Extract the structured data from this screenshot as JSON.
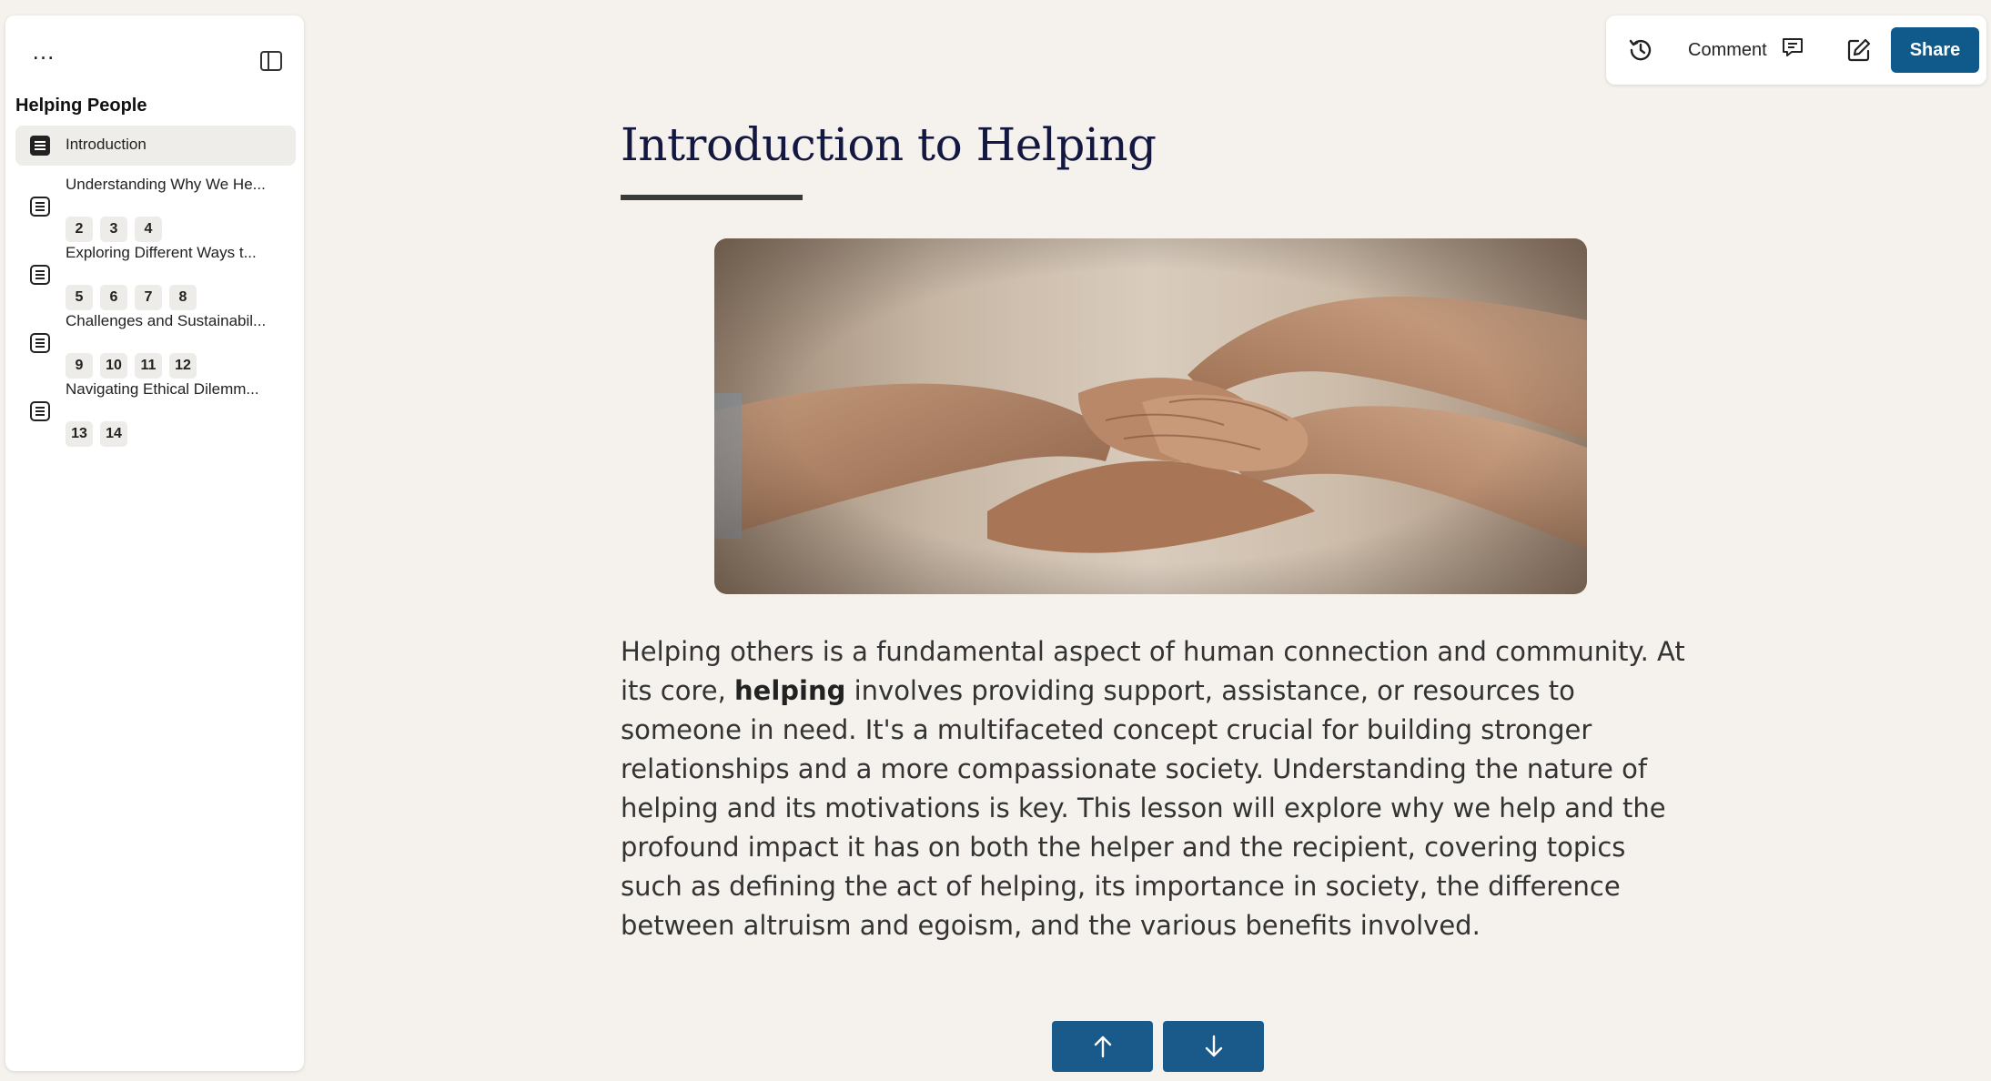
{
  "sidebar": {
    "more_label": "...",
    "title": "Helping People",
    "items": [
      {
        "label": "Introduction",
        "chips": []
      },
      {
        "label": "Understanding Why We He...",
        "chips": [
          "2",
          "3",
          "4"
        ]
      },
      {
        "label": "Exploring Different Ways t...",
        "chips": [
          "5",
          "6",
          "7",
          "8"
        ]
      },
      {
        "label": "Challenges and Sustainabil...",
        "chips": [
          "9",
          "10",
          "11",
          "12"
        ]
      },
      {
        "label": "Navigating Ethical Dilemm...",
        "chips": [
          "13",
          "14"
        ]
      }
    ]
  },
  "toolbar": {
    "comment_label": "Comment",
    "share_label": "Share"
  },
  "content": {
    "title": "Introduction to Helping",
    "paragraph_before": "Helping others is a fundamental aspect of human connection and community. At its core, ",
    "paragraph_bold": "helping",
    "paragraph_after": " involves providing support, assistance, or resources to someone in need. It's a multifaceted concept crucial for building stronger relationships and a more compassionate society. Understanding the nature of helping and its motivations is key. This lesson will explore why we help and the profound impact it has on both the helper and the recipient, covering topics such as defining the act of helping, its importance in society, the difference between altruism and egoism, and the various benefits involved."
  },
  "colors": {
    "accent": "#0f5a8b",
    "nav_button": "#1a5a8b",
    "background": "#f5f2ed",
    "title": "#14173f"
  },
  "icons": {
    "sidebar_toggle": "sidebar-toggle-icon",
    "doc": "document-icon",
    "history": "history-icon",
    "comment": "comment-icon",
    "edit": "edit-icon",
    "up": "arrow-up-icon",
    "down": "arrow-down-icon"
  }
}
